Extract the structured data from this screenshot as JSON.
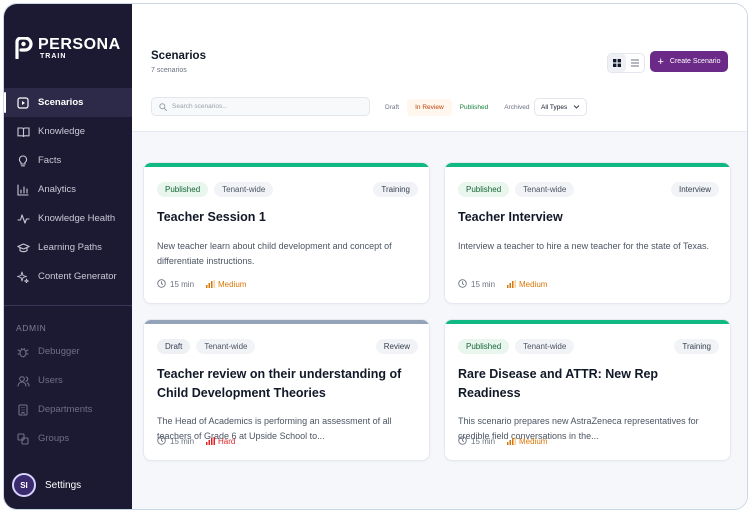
{
  "brand": {
    "name": "PERSONA",
    "sub": "TRAIN"
  },
  "sidebar": {
    "items": [
      {
        "label": "Scenarios",
        "icon": "play-square-icon",
        "active": true
      },
      {
        "label": "Knowledge",
        "icon": "book-icon"
      },
      {
        "label": "Facts",
        "icon": "lightbulb-icon"
      },
      {
        "label": "Analytics",
        "icon": "bar-chart-icon"
      },
      {
        "label": "Knowledge Health",
        "icon": "activity-icon"
      },
      {
        "label": "Learning Paths",
        "icon": "graduation-cap-icon"
      },
      {
        "label": "Content Generator",
        "icon": "sparkles-icon"
      }
    ],
    "admin_label": "ADMIN",
    "admin_items": [
      {
        "label": "Debugger",
        "icon": "bug-icon"
      },
      {
        "label": "Users",
        "icon": "users-icon"
      },
      {
        "label": "Departments",
        "icon": "building-icon"
      },
      {
        "label": "Groups",
        "icon": "groups-icon"
      }
    ],
    "user": {
      "initials": "SI",
      "label": "Settings"
    }
  },
  "header": {
    "title": "Scenarios",
    "subtitle": "7 scenarios",
    "create_label": "Create Scenario"
  },
  "search": {
    "placeholder": "Search scenarios...",
    "value": ""
  },
  "filters": {
    "status": [
      "Draft",
      "In Review",
      "Published",
      "Archived"
    ],
    "type_select": "All Types"
  },
  "colors": {
    "accent": "#6b2a87",
    "published_bar": "#10b981",
    "draft_bar": "#94a3b8",
    "medium": "#d97706",
    "hard": "#dc2626"
  },
  "cards": [
    {
      "status": "Published",
      "scope": "Tenant-wide",
      "type": "Training",
      "title": "Teacher Session 1",
      "description": "New teacher learn about child development and concept of differentiate instructions.",
      "duration": "15 min",
      "difficulty": "Medium"
    },
    {
      "status": "Published",
      "scope": "Tenant-wide",
      "type": "Interview",
      "title": "Teacher Interview",
      "description": "Interview a teacher to hire a new teacher for the state of Texas.",
      "duration": "15 min",
      "difficulty": "Medium"
    },
    {
      "status": "Draft",
      "scope": "Tenant-wide",
      "type": "Review",
      "title": "Teacher review on their understanding of Child Development Theories",
      "description": "The Head of Academics is performing an assessment of all teachers of Grade 6 at Upside School to...",
      "duration": "15 min",
      "difficulty": "Hard"
    },
    {
      "status": "Published",
      "scope": "Tenant-wide",
      "type": "Training",
      "title": "Rare Disease and ATTR: New Rep Readiness",
      "description": "This scenario prepares new AstraZeneca representatives for credible field conversations in the...",
      "duration": "15 min",
      "difficulty": "Medium"
    }
  ]
}
